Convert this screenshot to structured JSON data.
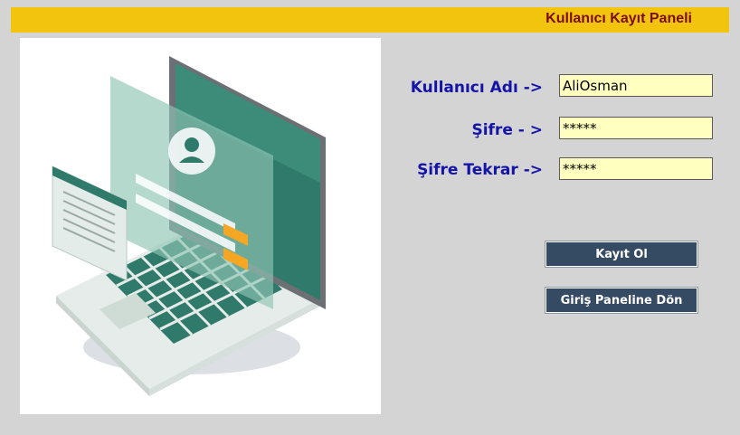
{
  "header": {
    "title": "Kullanıcı Kayıt Paneli"
  },
  "form": {
    "username_label": "Kullanıcı Adı ->",
    "username_value": "AliOsman",
    "password_label": "Şifre - >",
    "password_value": "*****",
    "password_repeat_label": "Şifre Tekrar ->",
    "password_repeat_value": "*****"
  },
  "buttons": {
    "register_label": "Kayıt Ol",
    "back_to_login_label": "Giriş Paneline Dön"
  },
  "illustration": {
    "icon": "laptop-login-illustration"
  },
  "colors": {
    "title_bar": "#f2c40e",
    "title_text": "#7a0c0c",
    "label_text": "#1414a8",
    "input_bg": "#ffffc0",
    "button_bg": "#354b63"
  }
}
